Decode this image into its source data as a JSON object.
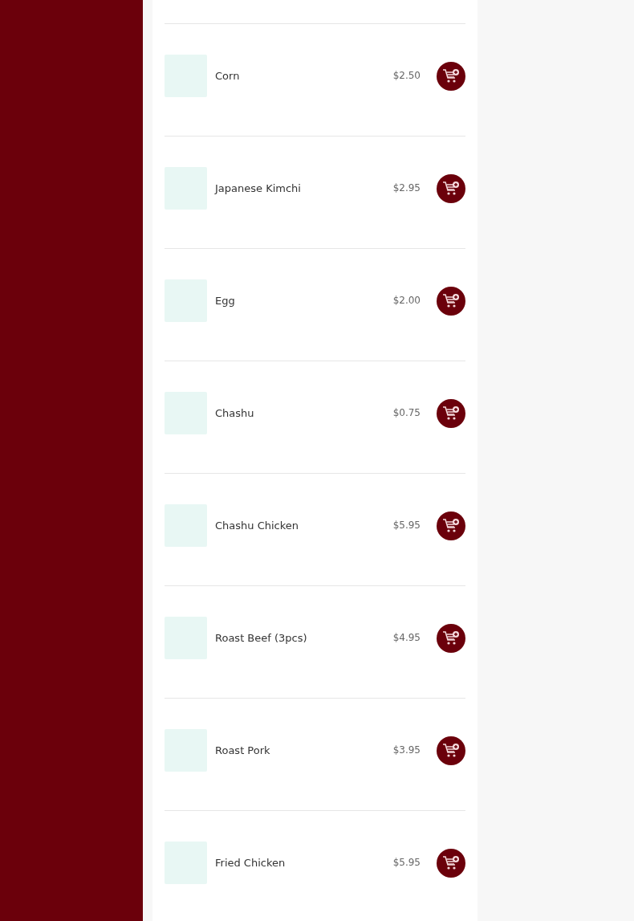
{
  "menu_items": [
    {
      "name": "Corn",
      "price": "$2.50"
    },
    {
      "name": "Japanese Kimchi",
      "price": "$2.95"
    },
    {
      "name": "Egg",
      "price": "$2.00"
    },
    {
      "name": "Chashu",
      "price": "$0.75"
    },
    {
      "name": "Chashu Chicken",
      "price": "$5.95"
    },
    {
      "name": "Roast Beef (3pcs)",
      "price": "$4.95"
    },
    {
      "name": "Roast Pork",
      "price": "$3.95"
    },
    {
      "name": "Fried Chicken",
      "price": "$5.95"
    }
  ]
}
